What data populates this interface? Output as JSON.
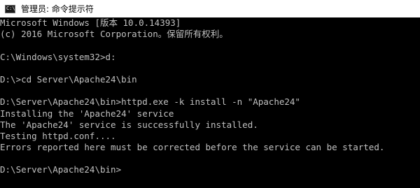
{
  "window": {
    "icon_glyph": "C:\\",
    "title": "管理员: 命令提示符"
  },
  "console": {
    "lines": [
      "Microsoft Windows [版本 10.0.14393]",
      "(c) 2016 Microsoft Corporation。保留所有权利。",
      "",
      "C:\\Windows\\system32>d:",
      "",
      "D:\\>cd Server\\Apache24\\bin",
      "",
      "D:\\Server\\Apache24\\bin>httpd.exe -k install -n \"Apache24\"",
      "Installing the 'Apache24' service",
      "The 'Apache24' service is successfully installed.",
      "Testing httpd.conf....",
      "Errors reported here must be corrected before the service can be started.",
      "",
      "D:\\Server\\Apache24\\bin>"
    ]
  },
  "colors": {
    "console_background": "#000000",
    "console_text": "#c0c0c0",
    "titlebar_background": "#ffffff"
  }
}
